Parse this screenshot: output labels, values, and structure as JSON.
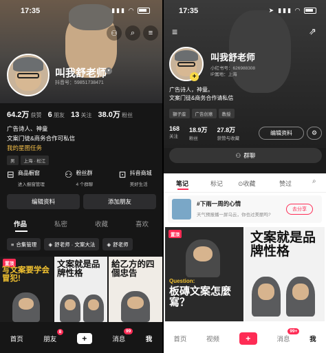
{
  "left": {
    "status": {
      "time": "17:35"
    },
    "header_icons": [
      "group-icon",
      "search-icon",
      "menu-icon"
    ],
    "profile": {
      "name": "叫我舒老师",
      "id": "抖音号：59851738471"
    },
    "stats": [
      {
        "value": "64.2万",
        "label": "获赞"
      },
      {
        "value": "6",
        "label": "朋友"
      },
      {
        "value": "13",
        "label": "关注"
      },
      {
        "value": "38.0万",
        "label": "粉丝"
      }
    ],
    "bio": [
      "广告诗人、神童",
      "文案门徒&商务合作可私信",
      "我的星图任务"
    ],
    "tags": [
      "男",
      "上海 · 松江"
    ],
    "services": [
      {
        "title": "商品橱窗",
        "sub": "进入橱窗管理"
      },
      {
        "title": "粉丝群",
        "sub": "4 个群聊"
      },
      {
        "title": "抖音商城",
        "sub": "美好生活"
      }
    ],
    "buttons": {
      "edit": "编辑资料",
      "add_friend": "添加朋友"
    },
    "tabs": [
      "作品",
      "私密",
      "收藏",
      "喜欢"
    ],
    "chips": [
      "合集管理",
      "舒老师 · 文案大法",
      "舒老师"
    ],
    "thumbs": [
      {
        "title": "写文案要学会冒犯!",
        "badge": "置顶"
      },
      {
        "title": "文案就是品牌性格"
      },
      {
        "title": "給乙方的四個忠告"
      }
    ],
    "nav": {
      "items": [
        "首页",
        "朋友",
        "",
        "消息",
        "我"
      ],
      "badges": {
        "friends": "8",
        "messages": "99"
      }
    }
  },
  "right": {
    "status": {
      "time": "17:35"
    },
    "profile": {
      "name": "叫我舒老师",
      "id": "小红书号：626988308",
      "ip": "IP属地：上海"
    },
    "bio": [
      "广告诗人，神童。",
      "文案门徒&商务合作请私信"
    ],
    "tags": [
      "獅子座",
      "广告创意",
      "教授"
    ],
    "stats": [
      {
        "value": "168",
        "label": "关注"
      },
      {
        "value": "18.9万",
        "label": "粉丝"
      },
      {
        "value": "27.8万",
        "label": "获赞与收藏"
      }
    ],
    "buttons": {
      "edit": "编辑资料",
      "group_chat": "群聊"
    },
    "tabs": [
      "笔记",
      "标记",
      "收藏",
      "赞过"
    ],
    "promo": {
      "title": "#下雨一周的心情",
      "sub": "天气预报播一屏乌云，你也过美丽吗?",
      "button": "去分享"
    },
    "notes": [
      {
        "badge": "置顶",
        "question": "Question:",
        "title": "板磚文案怎麼寫？"
      },
      {
        "title": "文案就是品牌性格"
      }
    ],
    "nav": {
      "items": [
        "首页",
        "视频",
        "",
        "消息",
        "我"
      ],
      "badges": {
        "messages": "99+"
      }
    }
  }
}
